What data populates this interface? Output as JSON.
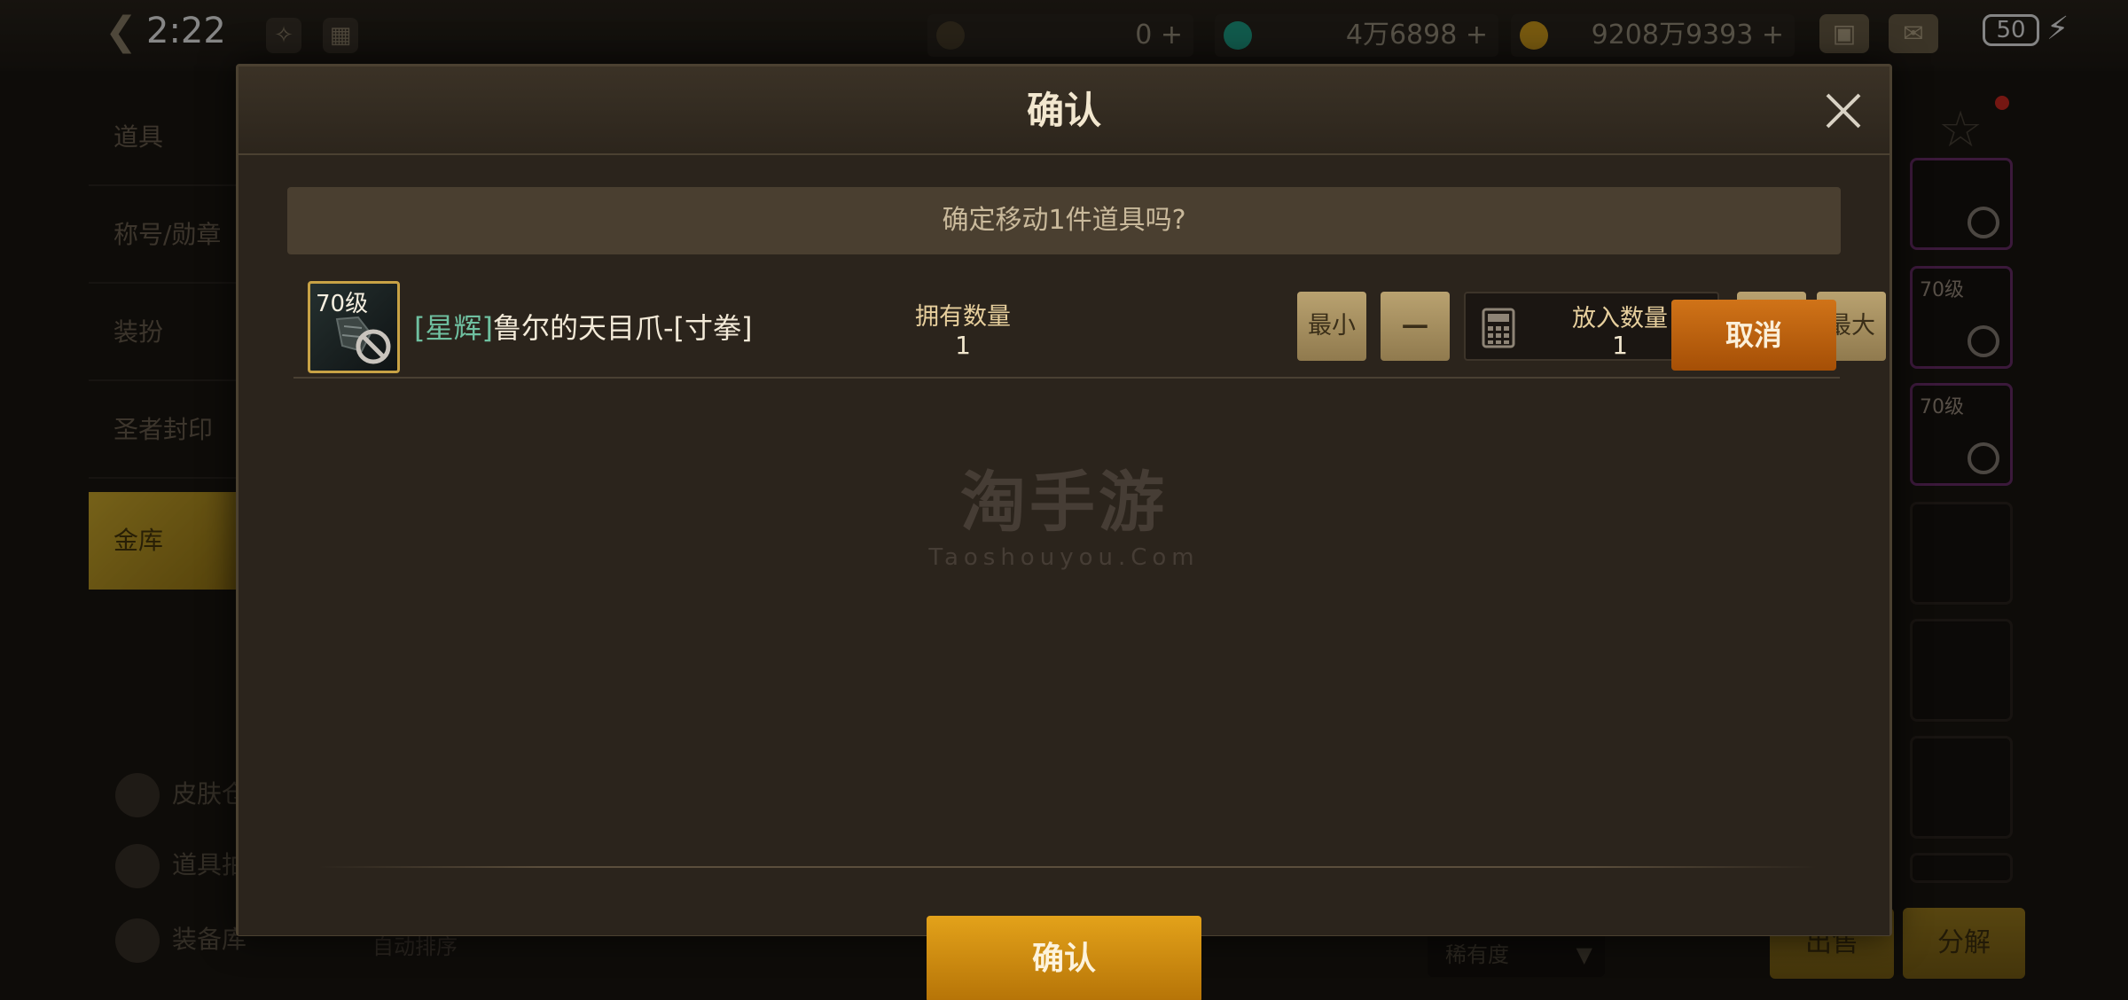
{
  "status_bar": {
    "time": "2:22",
    "battery": "50"
  },
  "currencies": [
    {
      "value": "0",
      "plus": "+",
      "icon": "coin-c-icon",
      "color": "#8c7a4a"
    },
    {
      "value": "4万6898",
      "plus": "+",
      "icon": "gem-icon",
      "color": "#1fa58a"
    },
    {
      "value": "9208万9393",
      "plus": "+",
      "icon": "gold-coin-icon",
      "color": "#d9a21d"
    }
  ],
  "side_menu": [
    "道具",
    "称号/勋章",
    "装扮",
    "圣者封印",
    "金库"
  ],
  "bottom_left": [
    "皮肤仓库",
    "道具拍卖",
    "装备库",
    "自动排序"
  ],
  "right_slots": {
    "level_label": "70级"
  },
  "bottom_right": {
    "sell_label": "出售",
    "decompose_label": "分解",
    "rarity_label": "稀有度"
  },
  "dialog": {
    "title": "确认",
    "prompt": "确定移动1件道具吗?",
    "item": {
      "level": "70级",
      "name_prefix": "[星辉]",
      "name": "鲁尔的天目爪-[寸拳]"
    },
    "owned_label": "拥有数量",
    "owned_value": "1",
    "min_label": "最小",
    "minus_label": "−",
    "qty_label": "放入数量",
    "qty_value": "1",
    "plus_label": "+",
    "max_label": "最大",
    "cancel_label": "取消",
    "confirm_label": "确认"
  },
  "watermark": {
    "main": "淘手游",
    "sub": "Taoshouyou.Com"
  },
  "colors": {
    "accent_gold": "#e3a21a",
    "cancel_orange": "#d07318",
    "name_prefix": "#6fc0a0",
    "item_border": "#c8a245"
  }
}
